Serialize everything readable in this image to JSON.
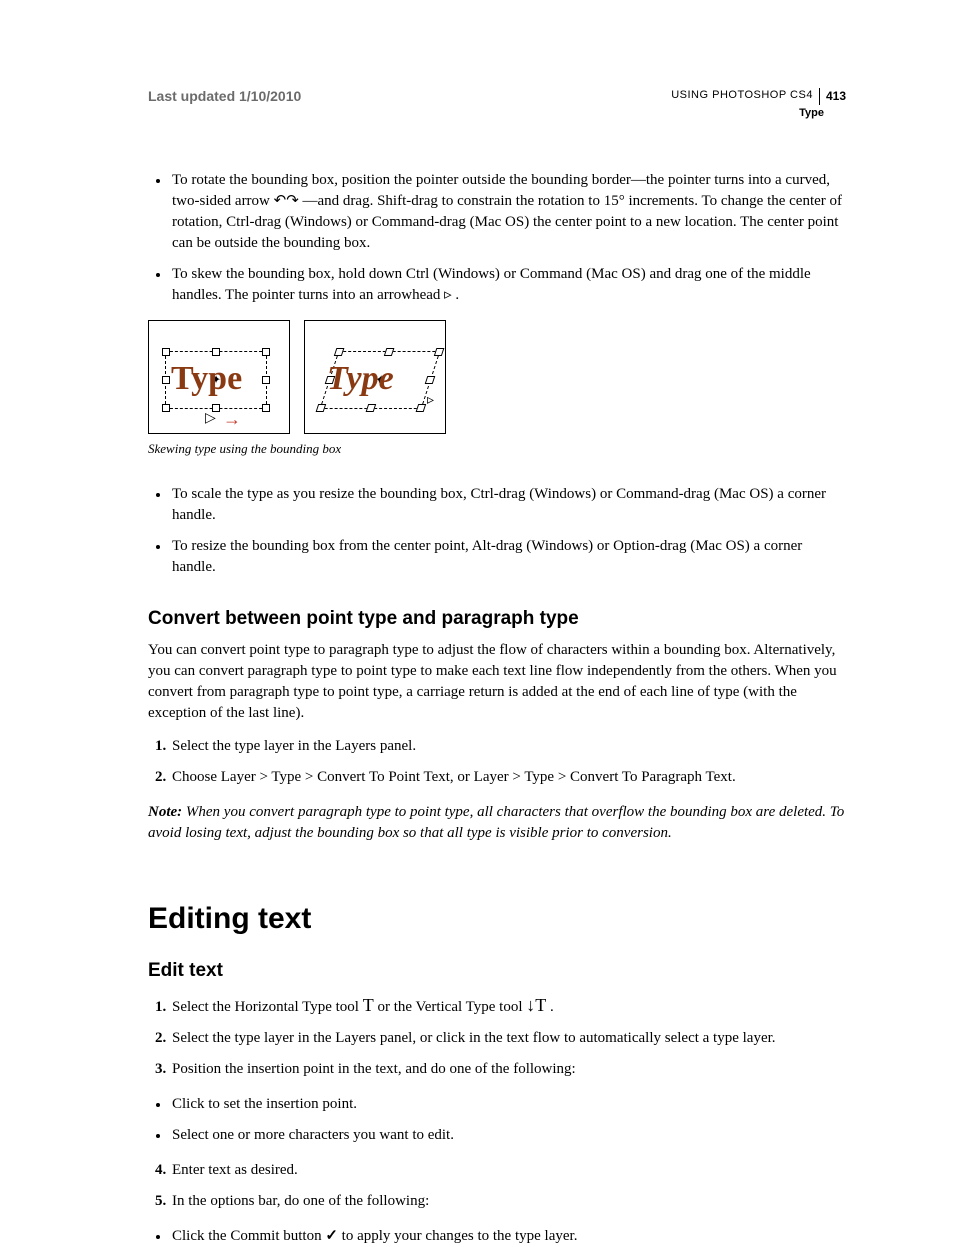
{
  "header": {
    "updated": "Last updated 1/10/2010",
    "product": "USING PHOTOSHOP CS4",
    "page_number": "413",
    "section": "Type"
  },
  "bullets_top": [
    "To rotate the bounding box, position the pointer outside the bounding border—the pointer turns into a curved, two-sided arrow  ↶↷ —and drag. Shift-drag to constrain the rotation to 15° increments. To change the center of rotation, Ctrl-drag (Windows) or Command-drag (Mac OS) the center point to a new location. The center point can be outside the bounding box.",
    "To skew the bounding box, hold down Ctrl (Windows) or Command (Mac OS) and drag one of the middle handles. The pointer turns into an arrowhead  ▹ ."
  ],
  "figure": {
    "label_a": "Type",
    "label_b": "Type",
    "caption": "Skewing type using the bounding box"
  },
  "bullets_mid": [
    "To scale the type as you resize the bounding box, Ctrl-drag (Windows) or Command-drag (Mac OS) a corner handle.",
    "To resize the bounding box from the center point, Alt-drag (Windows) or Option-drag (Mac OS) a corner handle."
  ],
  "convert": {
    "heading": "Convert between point type and paragraph type",
    "para": "You can convert point type to paragraph type to adjust the flow of characters within a bounding box. Alternatively, you can convert paragraph type to point type to make each text line flow independently from the others. When you convert from paragraph type to point type, a carriage return is added at the end of each line of type (with the exception of the last line).",
    "steps": [
      "Select the type layer in the Layers panel.",
      "Choose Layer > Type > Convert To Point Text, or Layer > Type > Convert To Paragraph Text."
    ],
    "note_label": "Note:",
    "note_body": " When you convert paragraph type to point type, all characters that overflow the bounding box are deleted. To avoid losing text, adjust the bounding box so that all type is visible prior to conversion."
  },
  "editing": {
    "title": "Editing text",
    "subhead": "Edit text",
    "steps": [
      {
        "pre": "Select the Horizontal Type tool ",
        "icon": "T",
        "mid": " or the Vertical Type tool ",
        "icon2": "↓T",
        "post": " ."
      },
      {
        "text": "Select the type layer in the Layers panel, or click in the text flow to automatically select a type layer."
      },
      {
        "text": "Position the insertion point in the text, and do one of the following:"
      }
    ],
    "sub_bullets_3": [
      "Click to set the insertion point.",
      "Select one or more characters you want to edit."
    ],
    "steps_after": [
      {
        "num": "4",
        "text": "Enter text as desired."
      },
      {
        "num": "5",
        "text": "In the options bar, do one of the following:"
      }
    ],
    "sub_bullets_5": [
      {
        "pre": "Click the Commit button ",
        "icon": "✓",
        "post": " to apply your changes to the type layer."
      }
    ]
  }
}
